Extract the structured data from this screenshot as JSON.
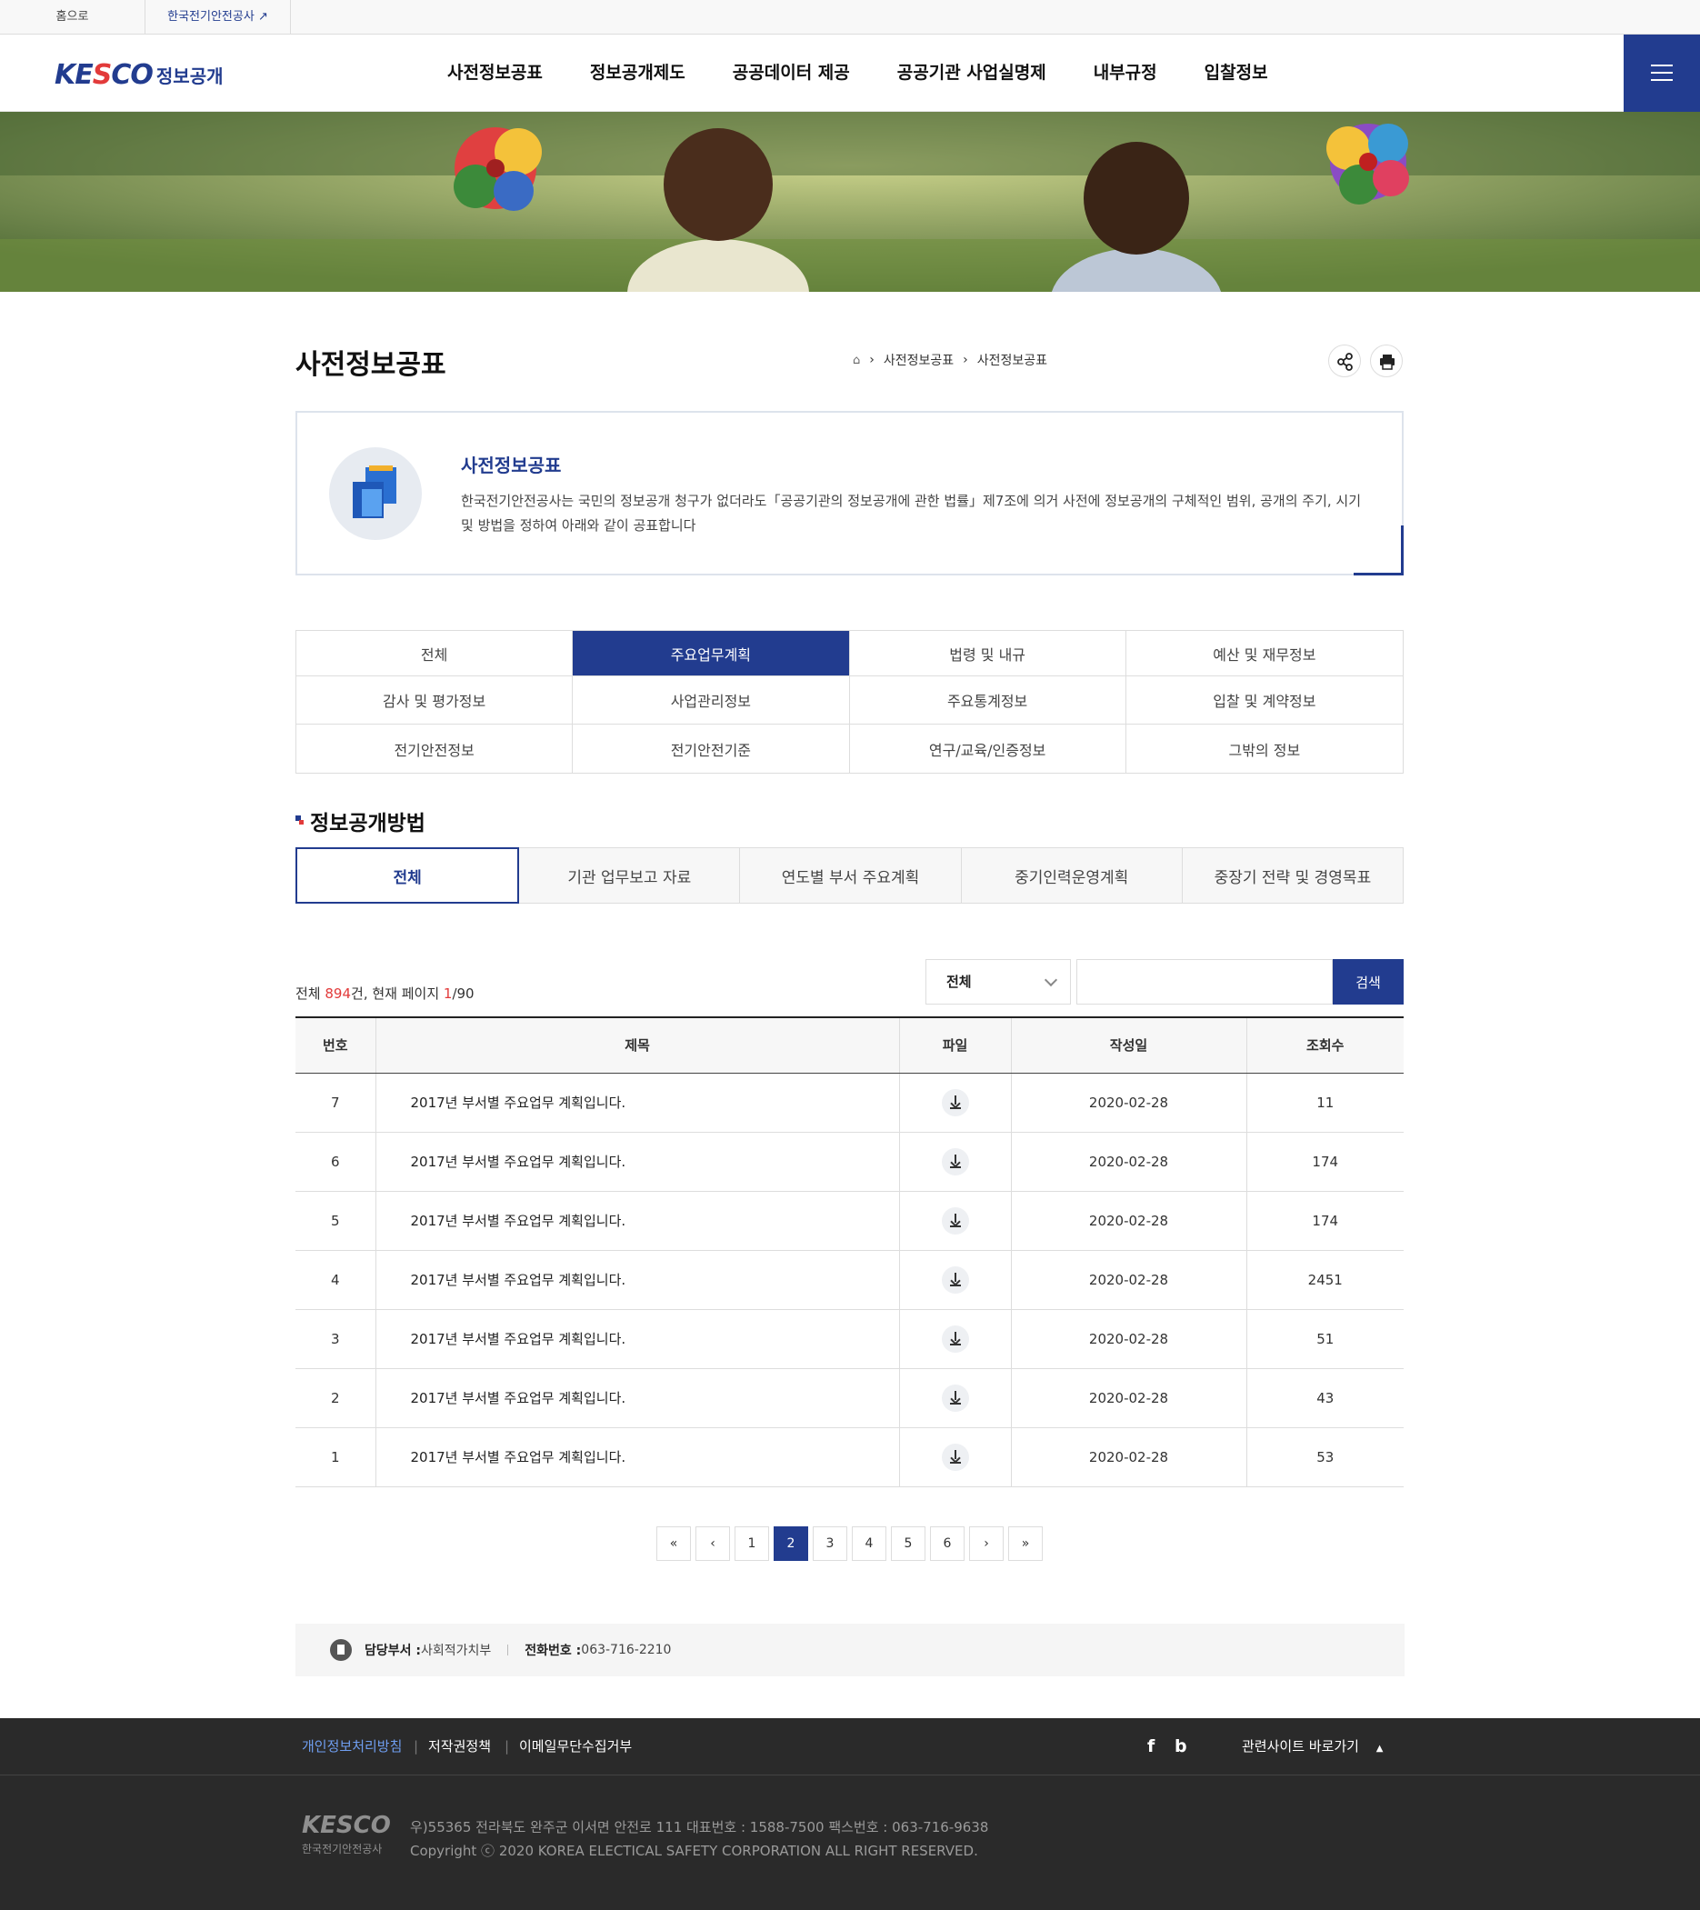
{
  "util": {
    "home": "홈으로",
    "kesco": "한국전기안전공사"
  },
  "header": {
    "logo_mark": "KESCO",
    "logo_text": "정보공개",
    "nav": [
      "사전정보공표",
      "정보공개제도",
      "공공데이터 제공",
      "공공기관 사업실명제",
      "내부규정",
      "입찰정보"
    ]
  },
  "page": {
    "title": "사전정보공표",
    "breadcrumb": [
      "사전정보공표",
      "사전정보공표"
    ]
  },
  "intro": {
    "heading": "사전정보공표",
    "text": "한국전기안전공사는 국민의 정보공개 청구가 없더라도「공공기관의 정보공개에 관한 법률」제7조에 의거 사전에 정보공개의 구체적인 범위, 공개의 주기, 시기 및 방법을 정하여 아래와 같이 공표합니다"
  },
  "categories": [
    "전체",
    "주요업무계획",
    "법령 및 내규",
    "예산 및 재무정보",
    "감사 및 평가정보",
    "사업관리정보",
    "주요통계정보",
    "입찰 및 계약정보",
    "전기안전정보",
    "전기안전기준",
    "연구/교육/인증정보",
    "그밖의 정보"
  ],
  "active_category": "주요업무계획",
  "section_title": "정보공개방법",
  "tabs": [
    "전체",
    "기관 업무보고 자료",
    "연도별 부서 주요계획",
    "중기인력운영계획",
    "중장기 전략 및 경영목표"
  ],
  "active_tab": "전체",
  "summary": {
    "prefix": "전체 ",
    "total": "894",
    "mid": "건, 현재 페이지 ",
    "page": "1",
    "pages": "/90"
  },
  "search": {
    "select": "전체",
    "button": "검색"
  },
  "table": {
    "headers": [
      "번호",
      "제목",
      "파일",
      "작성일",
      "조회수"
    ],
    "rows": [
      {
        "no": "7",
        "title": "2017년 부서별 주요업무 계획입니다.",
        "date": "2020-02-28",
        "views": "11"
      },
      {
        "no": "6",
        "title": "2017년 부서별 주요업무 계획입니다.",
        "date": "2020-02-28",
        "views": "174"
      },
      {
        "no": "5",
        "title": "2017년 부서별 주요업무 계획입니다.",
        "date": "2020-02-28",
        "views": "174"
      },
      {
        "no": "4",
        "title": "2017년 부서별 주요업무 계획입니다.",
        "date": "2020-02-28",
        "views": "2451"
      },
      {
        "no": "3",
        "title": "2017년 부서별 주요업무 계획입니다.",
        "date": "2020-02-28",
        "views": "51"
      },
      {
        "no": "2",
        "title": "2017년 부서별 주요업무 계획입니다.",
        "date": "2020-02-28",
        "views": "43"
      },
      {
        "no": "1",
        "title": "2017년 부서별 주요업무 계획입니다.",
        "date": "2020-02-28",
        "views": "53"
      }
    ]
  },
  "pager": {
    "pages": [
      "1",
      "2",
      "3",
      "4",
      "5",
      "6"
    ],
    "current": "2"
  },
  "dept": {
    "dept_label": "담당부서 : ",
    "dept": "사회적가치부",
    "phone_label": "전화번호 : ",
    "phone": "063-716-2210"
  },
  "footer": {
    "links": [
      "개인정보처리방침",
      "저작권정책",
      "이메일무단수집거부"
    ],
    "social": [
      "f",
      "b"
    ],
    "related": "관련사이트 바로가기",
    "logo_mark": "KESCO",
    "logo_text": "한국전기안전공사",
    "address": "우)55365 전라북도 완주군 이서면 안전로 111   대표번호 : 1588-7500   팩스번호 : 063-716-9638",
    "copyright": "Copyright ⓒ 2020 KOREA ELECTICAL SAFETY CORPORATION ALL RIGHT RESERVED."
  },
  "colors": {
    "primary": "#223c8f",
    "accent": "#e23a3a",
    "footer_bg": "#2a2a2a"
  }
}
